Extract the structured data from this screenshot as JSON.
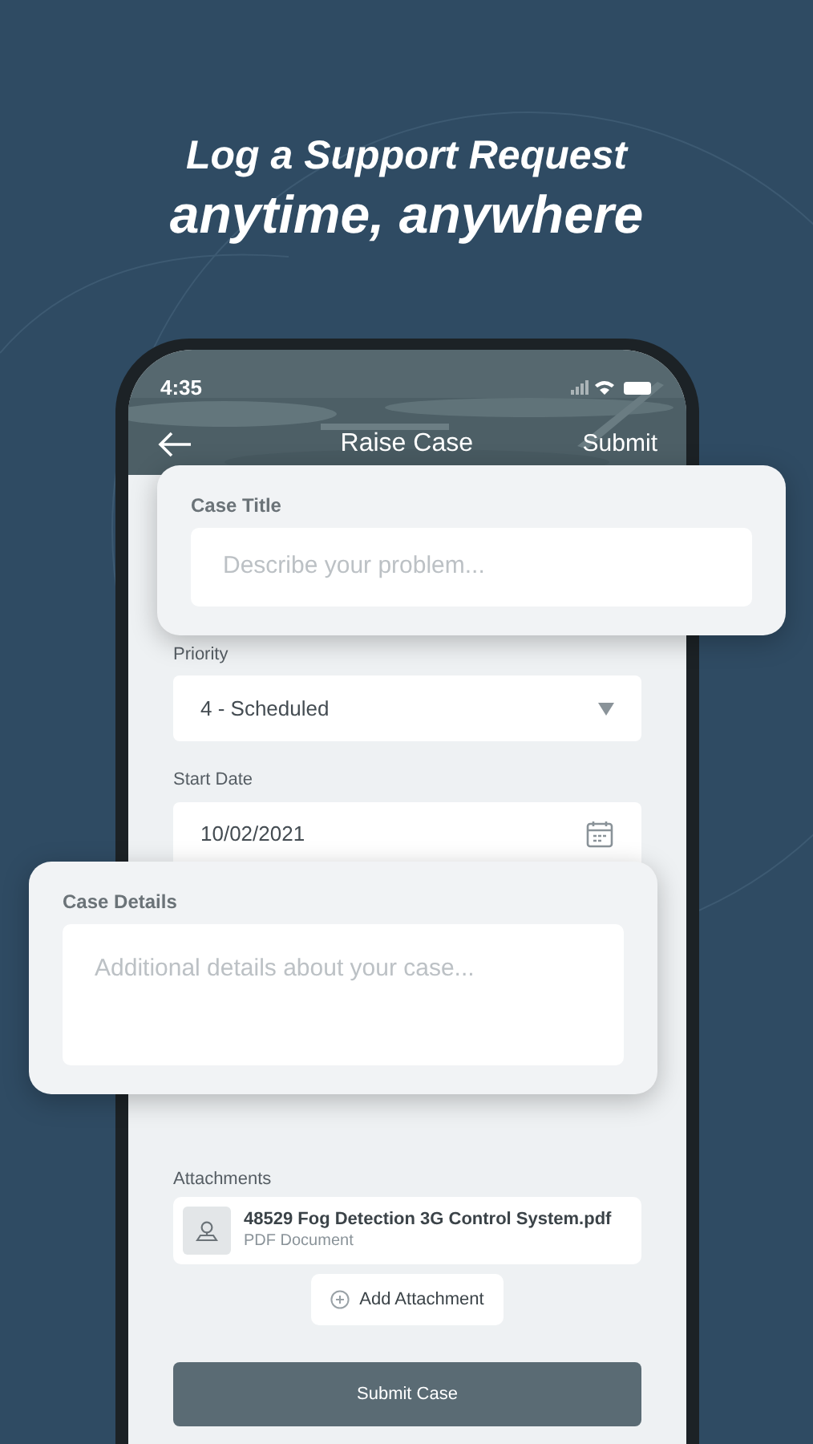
{
  "headline": [
    "Log a Support Request",
    "anytime, anywhere"
  ],
  "status_bar": {
    "time": "4:35"
  },
  "nav": {
    "title": "Raise Case",
    "action": "Submit"
  },
  "fields": [
    {
      "kind": "select",
      "label": "Priority",
      "value": "4 - Scheduled"
    },
    {
      "kind": "date",
      "label": "Start Date",
      "value": "10/02/2021"
    }
  ],
  "case_title": {
    "label": "Case Title",
    "placeholder": "Describe your problem..."
  },
  "case_details": {
    "label": "Case Details",
    "placeholder": "Additional details about your case..."
  },
  "attachments": {
    "label": "Attachments",
    "items": [
      {
        "name": "48529 Fog Detection 3G Control System.pdf",
        "type": "PDF Document"
      }
    ]
  },
  "add_button": "Add Attachment",
  "submit_button": "Submit Case"
}
